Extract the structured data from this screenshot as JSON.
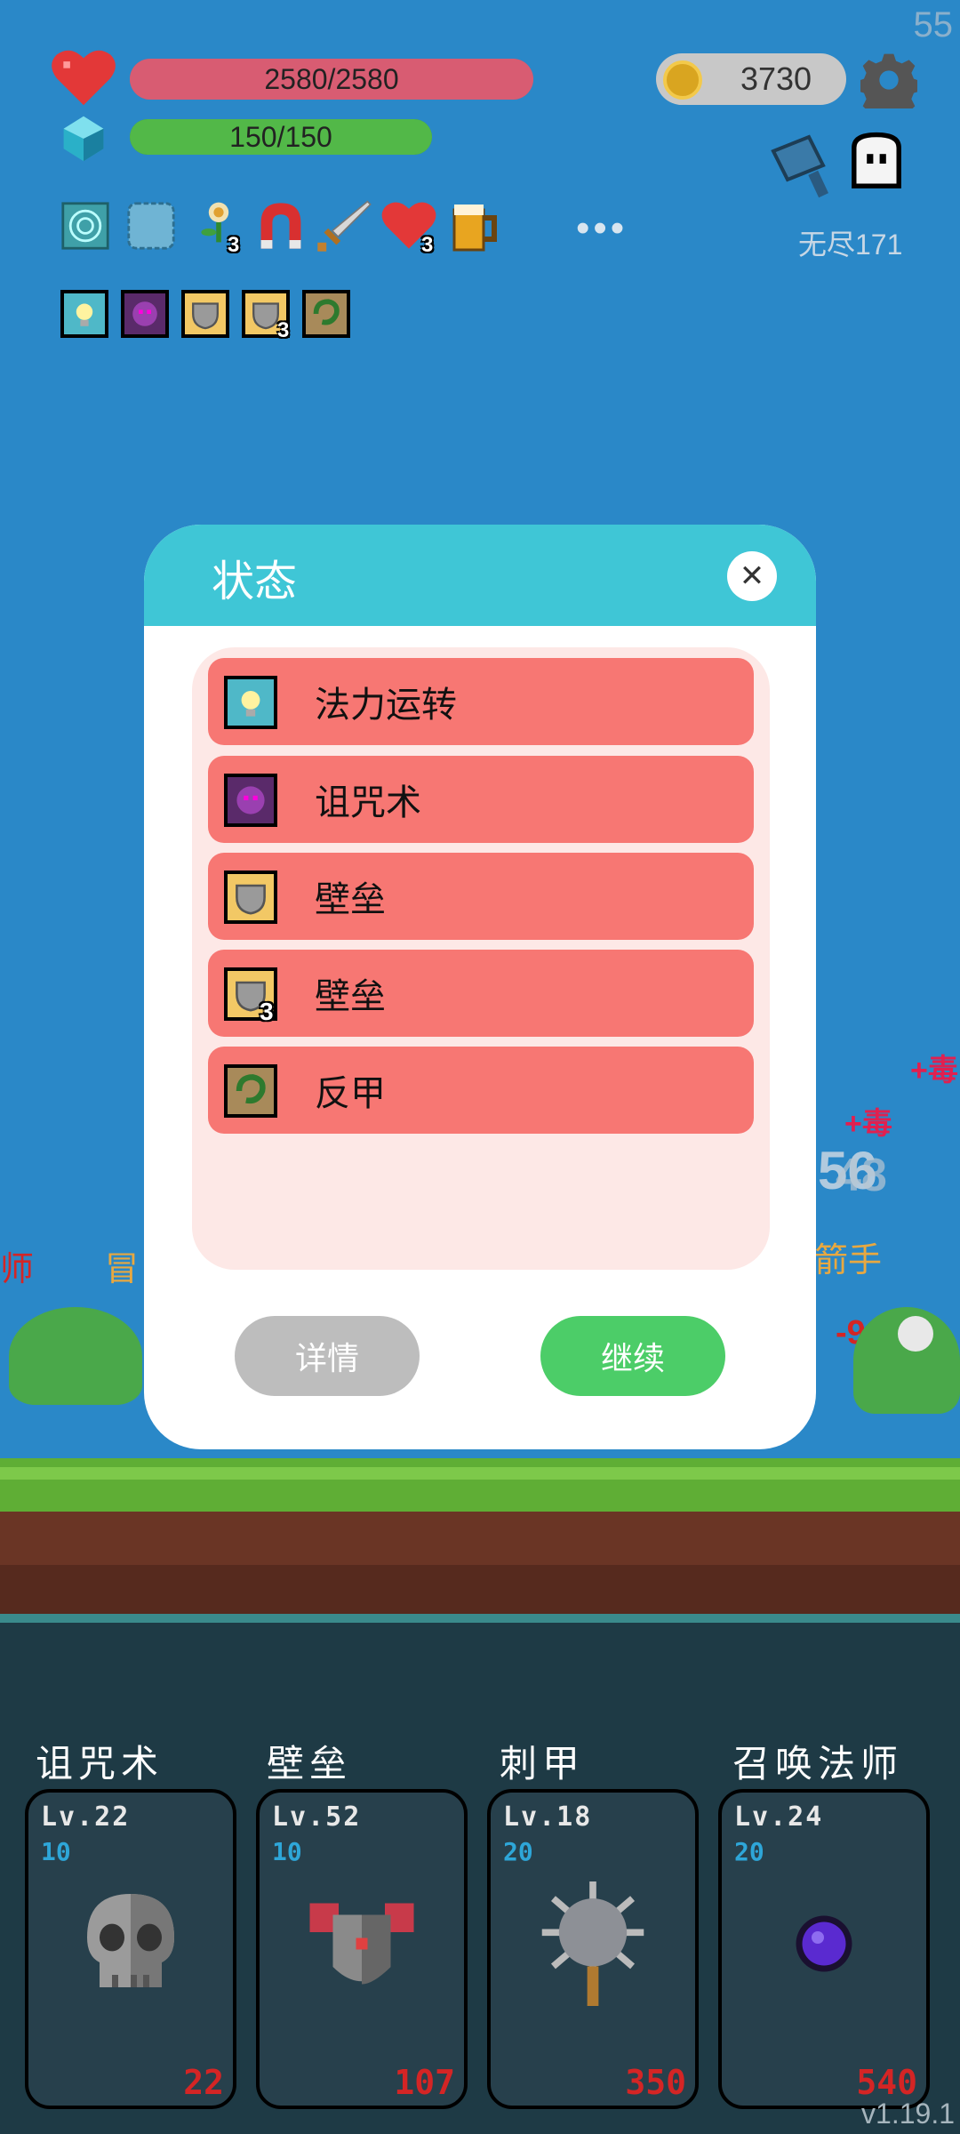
{
  "hud": {
    "fps": "55",
    "hp_text": "2580/2580",
    "hp_fraction": 1.0,
    "mp_text": "150/150",
    "mp_fraction": 1.0,
    "coins": "3730",
    "mode_label": "无尽171",
    "more_label": "•••",
    "skill_badges": {
      "flower": "3",
      "heart": "3"
    },
    "buff_badge": "3"
  },
  "world": {
    "float_texts": [
      "+毒",
      "+毒",
      "-96",
      "冒",
      "箭手",
      "师"
    ],
    "damage_numbers": [
      "56",
      "48"
    ]
  },
  "modal": {
    "title": "状态",
    "close_label": "✕",
    "statuses": [
      {
        "label": "法力运转",
        "icon": "mana-flow-icon"
      },
      {
        "label": "诅咒术",
        "icon": "curse-icon"
      },
      {
        "label": "壁垒",
        "icon": "bulwark-icon"
      },
      {
        "label": "壁垒",
        "icon": "bulwark-icon",
        "badge": "3"
      },
      {
        "label": "反甲",
        "icon": "thorn-armor-icon"
      }
    ],
    "detail_label": "详情",
    "continue_label": "继续"
  },
  "cards": [
    {
      "title": "诅咒术",
      "level": "Lv.22",
      "cost": "10",
      "price": "22",
      "icon": "skull-icon"
    },
    {
      "title": "壁垒",
      "level": "Lv.52",
      "cost": "10",
      "price": "107",
      "icon": "armor-icon"
    },
    {
      "title": "刺甲",
      "level": "Lv.18",
      "cost": "20",
      "price": "350",
      "icon": "spiked-mace-icon"
    },
    {
      "title": "召唤法师",
      "level": "Lv.24",
      "cost": "20",
      "price": "540",
      "icon": "purple-orb-icon"
    }
  ],
  "version": "v1.19.1",
  "colors": {
    "accent": "#3fc6d6",
    "status_row": "#f77773",
    "confirm": "#4ccd68",
    "price": "#d42525"
  }
}
